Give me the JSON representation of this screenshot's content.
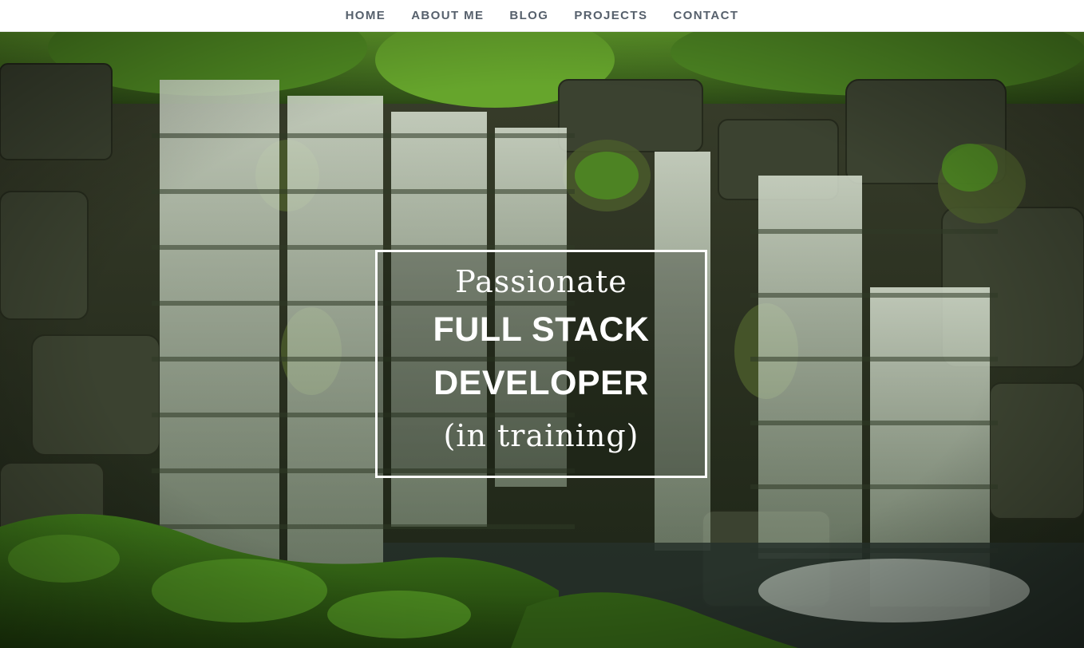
{
  "nav": {
    "items": [
      {
        "label": "HOME"
      },
      {
        "label": "ABOUT ME"
      },
      {
        "label": "BLOG"
      },
      {
        "label": "PROJECTS"
      },
      {
        "label": "CONTACT"
      }
    ]
  },
  "hero": {
    "line1": "Passionate",
    "line2": "FULL STACK",
    "line3": "DEVELOPER",
    "line4": "(in training)"
  },
  "colors": {
    "nav_text": "#56606c",
    "nav_bg": "#ffffff",
    "title_text": "#ffffff",
    "foliage": "#3c6a1c",
    "rock": "#2e3326",
    "water": "#c8d2c0"
  }
}
